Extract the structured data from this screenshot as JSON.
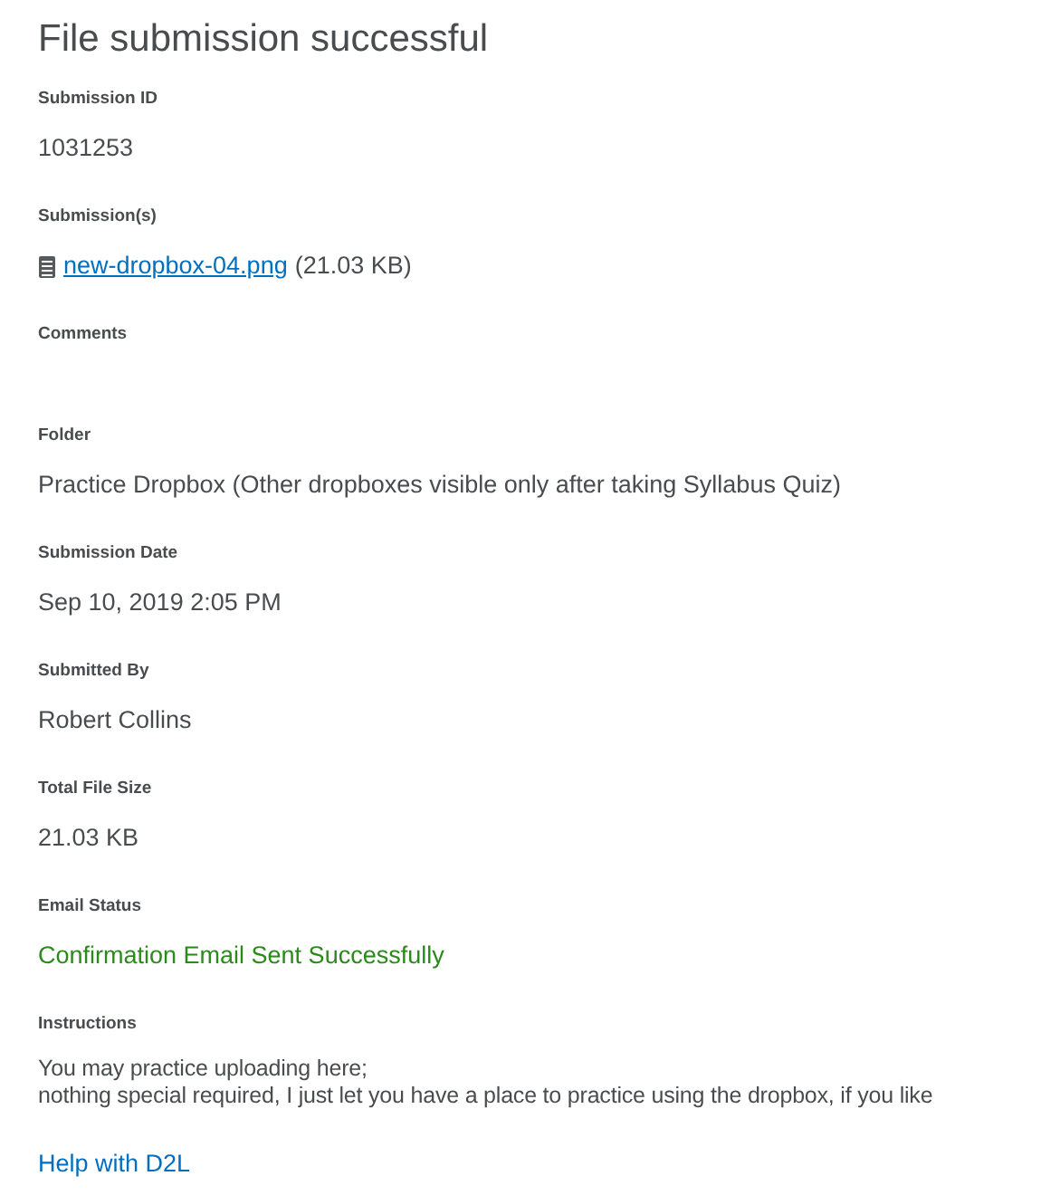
{
  "title": "File submission successful",
  "fields": [
    {
      "kind": "text",
      "label": "Submission ID",
      "value": "1031253"
    },
    {
      "kind": "file",
      "label": "Submission(s)",
      "file_name": "new-dropbox-04.png",
      "file_size": "(21.03 KB)"
    },
    {
      "kind": "empty",
      "label": "Comments"
    },
    {
      "kind": "text",
      "label": "Folder",
      "value": "Practice Dropbox (Other dropboxes visible only after taking Syllabus Quiz)"
    },
    {
      "kind": "text",
      "label": "Submission Date",
      "value": "Sep 10, 2019 2:05 PM"
    },
    {
      "kind": "text",
      "label": "Submitted By",
      "value": "Robert Collins"
    },
    {
      "kind": "text",
      "label": "Total File Size",
      "value": "21.03 KB"
    },
    {
      "kind": "status",
      "label": "Email Status",
      "value": "Confirmation Email Sent Successfully",
      "success": true
    },
    {
      "kind": "lines",
      "label": "Instructions",
      "lines": [
        "You may practice uploading here;",
        "nothing special required, I just let you have a place to practice using the dropbox, if you like"
      ]
    }
  ],
  "help_link": "Help with D2L"
}
